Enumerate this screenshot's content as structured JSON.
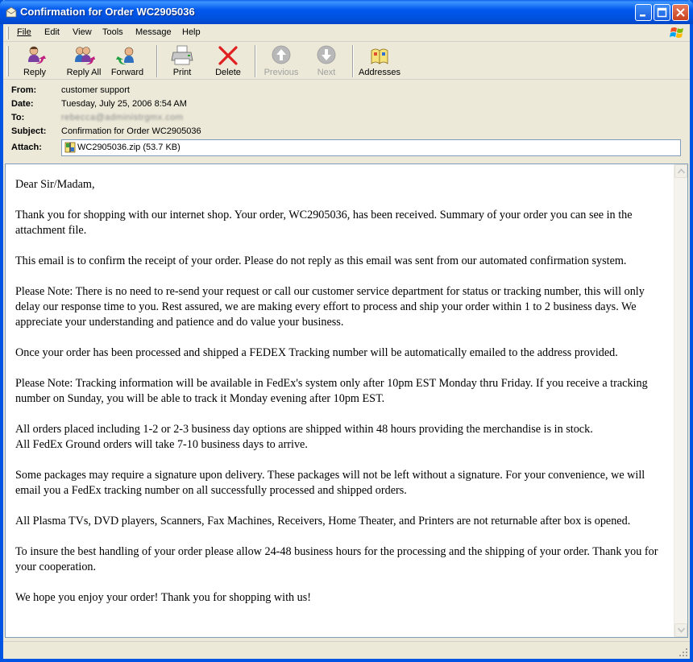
{
  "window": {
    "title": "Confirmation for Order WC2905036",
    "icon": "mail-envelope-icon"
  },
  "menu": {
    "items": [
      {
        "label": "File",
        "accel": "F"
      },
      {
        "label": "Edit",
        "accel": "E"
      },
      {
        "label": "View",
        "accel": "V"
      },
      {
        "label": "Tools",
        "accel": "T"
      },
      {
        "label": "Message",
        "accel": "M"
      },
      {
        "label": "Help",
        "accel": "H"
      }
    ]
  },
  "toolbar": {
    "reply": "Reply",
    "reply_all": "Reply All",
    "forward": "Forward",
    "print": "Print",
    "delete": "Delete",
    "previous": "Previous",
    "next": "Next",
    "addresses": "Addresses"
  },
  "headers": {
    "from_label": "From:",
    "from": "customer support",
    "date_label": "Date:",
    "date": "Tuesday, July 25, 2006 8:54 AM",
    "to_label": "To:",
    "to": "rebecca@administrgmx.com",
    "subject_label": "Subject:",
    "subject": "Confirmation for Order WC2905036",
    "attach_label": "Attach:",
    "attachment": "WC2905036.zip (53.7 KB)"
  },
  "body": {
    "paragraphs": [
      "Dear Sir/Madam,",
      "Thank you for shopping with our internet shop. Your order, WC2905036, has been received. Summary of your order you can see in the attachment file.",
      "This email is to confirm the receipt of your order. Please do not reply as this email was sent from our automated confirmation system.",
      "Please Note: There is no need to re-send your request or call our customer service department for status or tracking number, this will only delay our response time to you. Rest assured, we are making every effort to process and ship your order within 1 to 2 business days. We appreciate your understanding and patience and do value your business.",
      "Once your order has been processed and shipped a FEDEX Tracking number will be automatically emailed to the address provided.",
      "Please Note: Tracking information will be available in FedEx's system only after 10pm EST Monday thru Friday. If you receive a tracking number on Sunday, you will be able to track it Monday evening after 10pm EST.",
      "All orders placed including 1-2 or 2-3 business day options are shipped within 48 hours providing the merchandise is in stock.\nAll FedEx Ground orders will take 7-10 business days to arrive.",
      "Some packages may require a signature upon delivery. These packages will not be left without a signature. For your convenience, we will email you a FedEx tracking number on all successfully processed and shipped orders.",
      "All Plasma TVs, DVD players, Scanners, Fax Machines, Receivers, Home Theater, and Printers are not returnable after box is opened.",
      "To insure the best handling of your order please allow 24-48 business hours for the processing and the shipping of your order. Thank you for your cooperation.",
      "We hope you enjoy your order!  Thank you for shopping with us!"
    ]
  },
  "colors": {
    "titlebar": "#0054E3",
    "chrome": "#ECE9D8",
    "delete_red": "#E02020"
  }
}
